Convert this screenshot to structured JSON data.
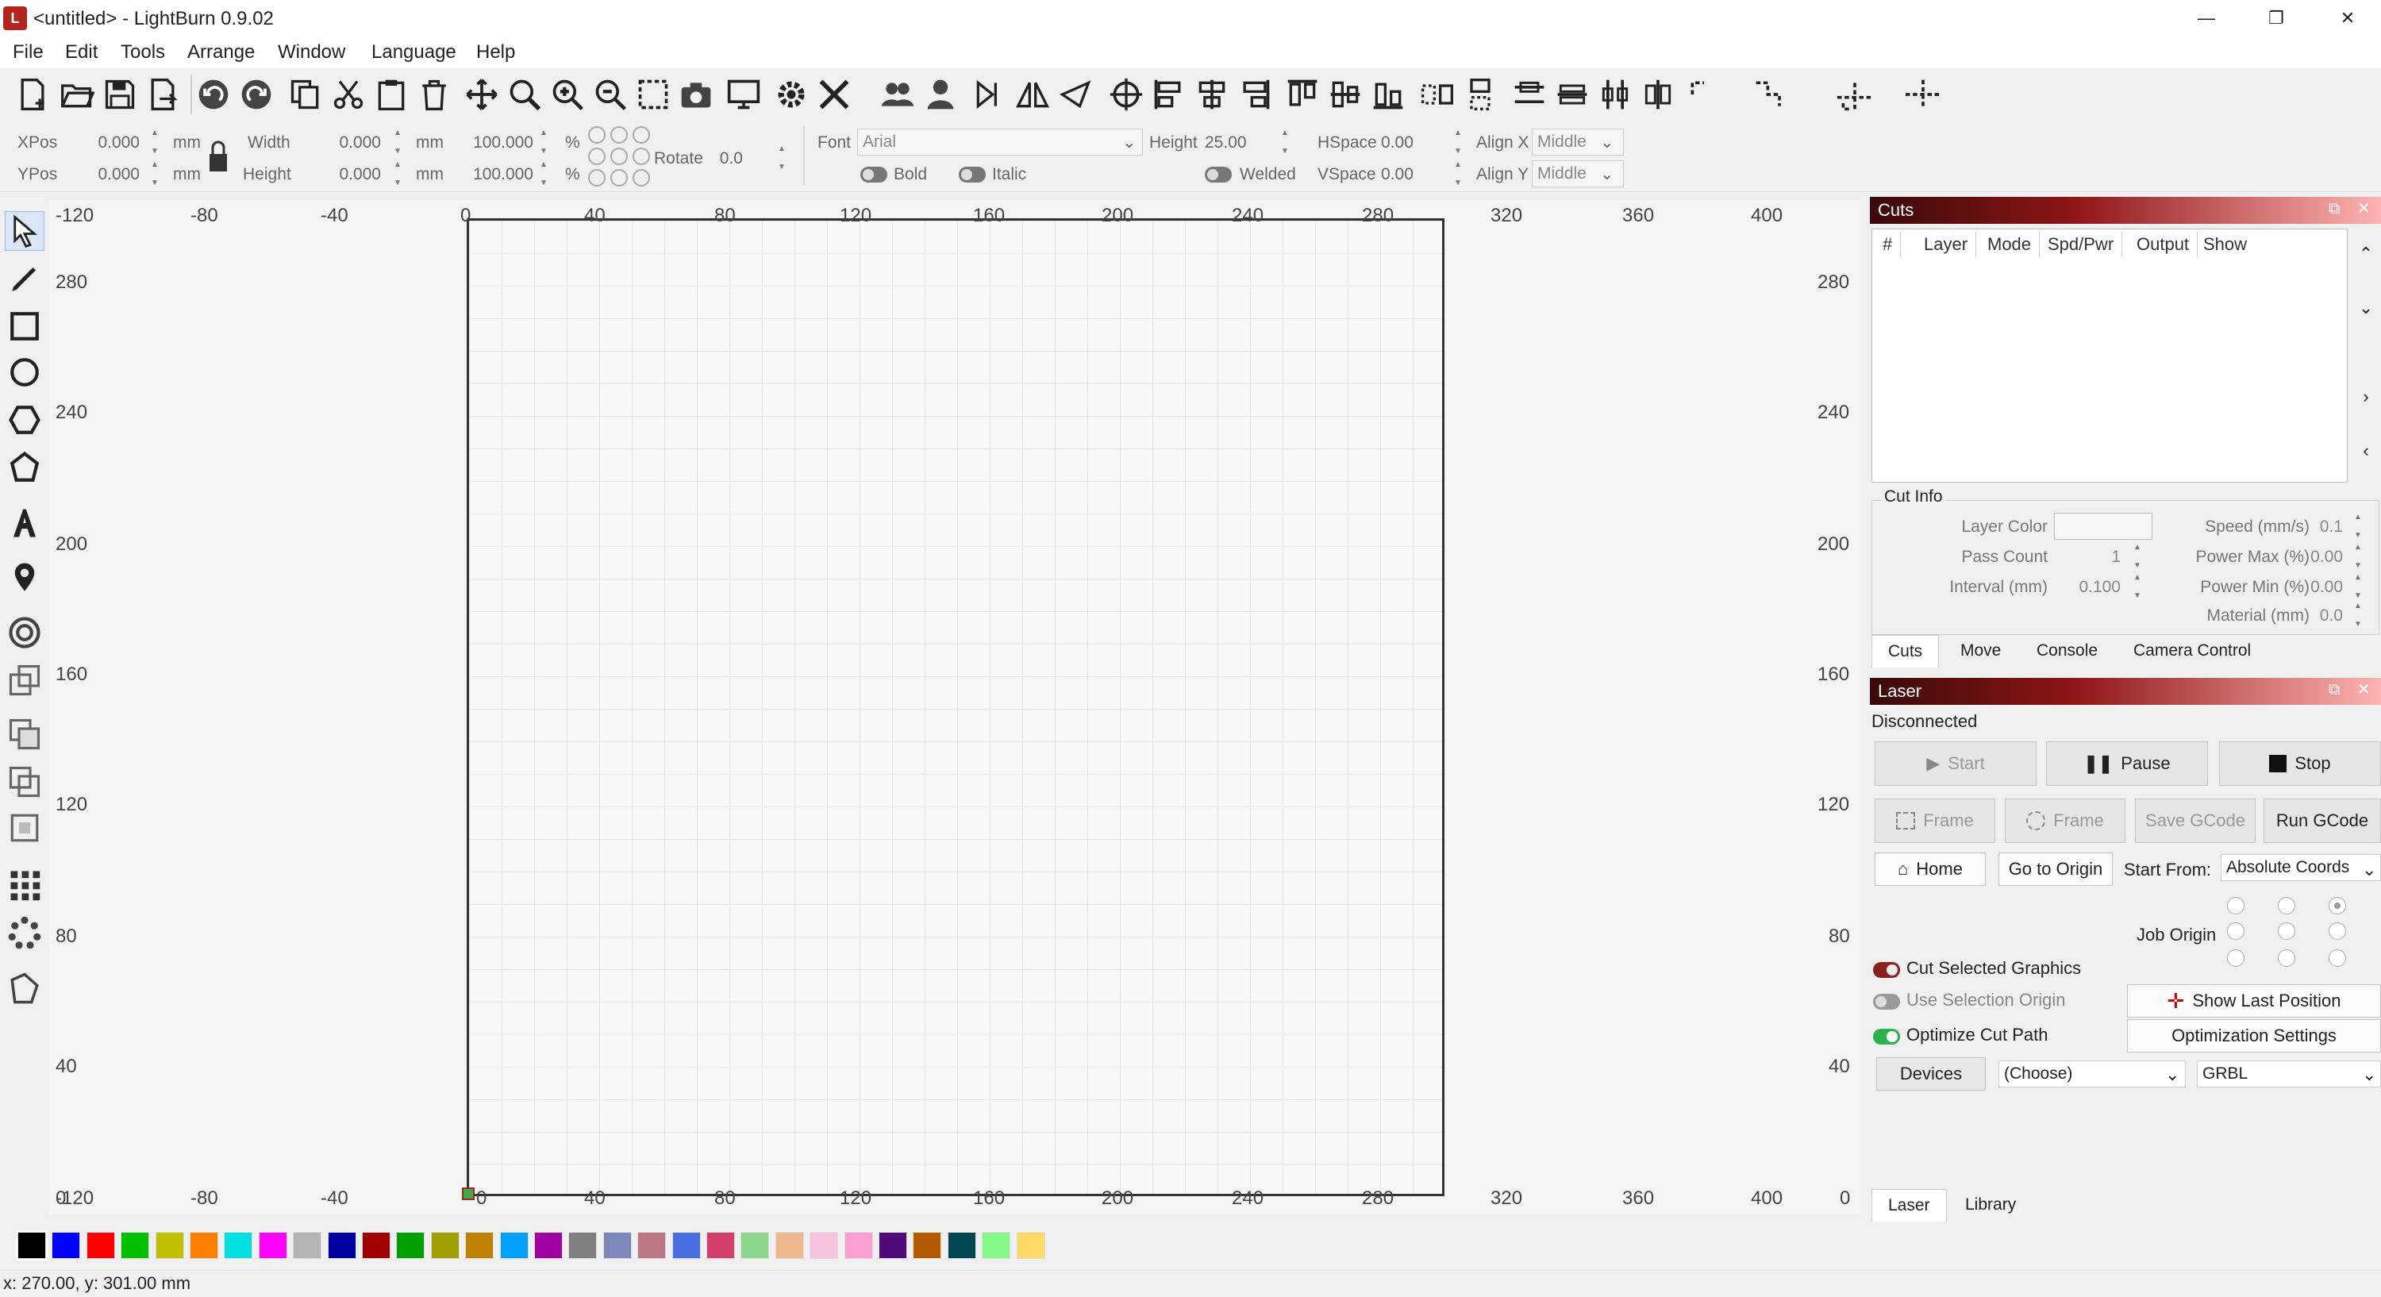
{
  "window": {
    "title": "<untitled> - LightBurn 0.9.02",
    "minimize": "—",
    "maximize": "❐",
    "close": "✕"
  },
  "menu": [
    "File",
    "Edit",
    "Tools",
    "Arrange",
    "Window",
    "Language",
    "Help"
  ],
  "props": {
    "xpos_label": "XPos",
    "xpos": "0.000",
    "ypos_label": "YPos",
    "ypos": "0.000",
    "unit": "mm",
    "width_label": "Width",
    "width": "0.000",
    "height_label": "Height",
    "height": "0.000",
    "scale_w": "100.000",
    "scale_h": "100.000",
    "pct": "%",
    "rotate_label": "Rotate",
    "rotate": "0.0",
    "font_label": "Font",
    "font": "Arial",
    "text_height_label": "Height",
    "text_height": "25.00",
    "hspace_label": "HSpace",
    "hspace": "0.00",
    "vspace_label": "VSpace",
    "vspace": "0.00",
    "alignx_label": "Align X",
    "alignx": "Middle",
    "aligny_label": "Align Y",
    "aligny": "Middle",
    "bold": "Bold",
    "italic": "Italic",
    "welded": "Welded"
  },
  "ruler": {
    "top": [
      "-120",
      "-80",
      "-40",
      "0",
      "40",
      "80",
      "120",
      "160",
      "200",
      "240",
      "280",
      "320",
      "360",
      "400"
    ],
    "bottom": [
      "-120",
      "-80",
      "-40",
      "0",
      "40",
      "80",
      "120",
      "160",
      "200",
      "240",
      "280",
      "320",
      "360",
      "400"
    ],
    "left": [
      "280",
      "240",
      "200",
      "160",
      "120",
      "80",
      "40",
      "0"
    ],
    "right": [
      "280",
      "240",
      "200",
      "160",
      "120",
      "80",
      "40",
      "0"
    ]
  },
  "cuts": {
    "title": "Cuts",
    "columns": [
      "#",
      "Layer",
      "Mode",
      "Spd/Pwr",
      "Output",
      "Show"
    ],
    "cut_info_title": "Cut Info",
    "layer_color_label": "Layer Color",
    "pass_count_label": "Pass Count",
    "pass_count": "1",
    "interval_label": "Interval (mm)",
    "interval": "0.100",
    "speed_label": "Speed (mm/s)",
    "speed": "0.1",
    "power_max_label": "Power Max (%)",
    "power_max": "0.00",
    "power_min_label": "Power Min (%)",
    "power_min": "0.00",
    "material_label": "Material (mm)",
    "material": "0.0",
    "tabs": [
      "Cuts",
      "Move",
      "Console",
      "Camera Control"
    ]
  },
  "laser": {
    "title": "Laser",
    "status": "Disconnected",
    "start": "Start",
    "pause": "Pause",
    "stop": "Stop",
    "frame1": "Frame",
    "frame2": "Frame",
    "save_gcode": "Save GCode",
    "run_gcode": "Run GCode",
    "home": "Home",
    "go_origin": "Go to Origin",
    "start_from_label": "Start From:",
    "start_from": "Absolute Coords",
    "job_origin_label": "Job Origin",
    "cut_selected": "Cut Selected Graphics",
    "use_sel_origin": "Use Selection Origin",
    "optimize": "Optimize Cut Path",
    "show_last": "Show Last Position",
    "opt_settings": "Optimization Settings",
    "devices": "Devices",
    "device_choice": "(Choose)",
    "controller": "GRBL",
    "tabs": [
      "Laser",
      "Library"
    ]
  },
  "palette": [
    "#000000",
    "#0000ff",
    "#ff0000",
    "#00c000",
    "#c0c000",
    "#ff8000",
    "#00e0e0",
    "#ff00ff",
    "#b4b4b4",
    "#0000a0",
    "#a00000",
    "#00a000",
    "#a0a000",
    "#c08000",
    "#00a0ff",
    "#a000a0",
    "#808080",
    "#7d87b9",
    "#bb7784",
    "#4a6fe3",
    "#d33f6a",
    "#8cd78c",
    "#f0b98d",
    "#f6c4e1",
    "#fa9ed4",
    "#500a78",
    "#b45a00",
    "#004754",
    "#86fa88",
    "#ffdb66"
  ],
  "status": "x: 270.00, y: 301.00 mm",
  "colors": {
    "accent": "#8e1515",
    "toggle_on": "#2bb24c"
  }
}
